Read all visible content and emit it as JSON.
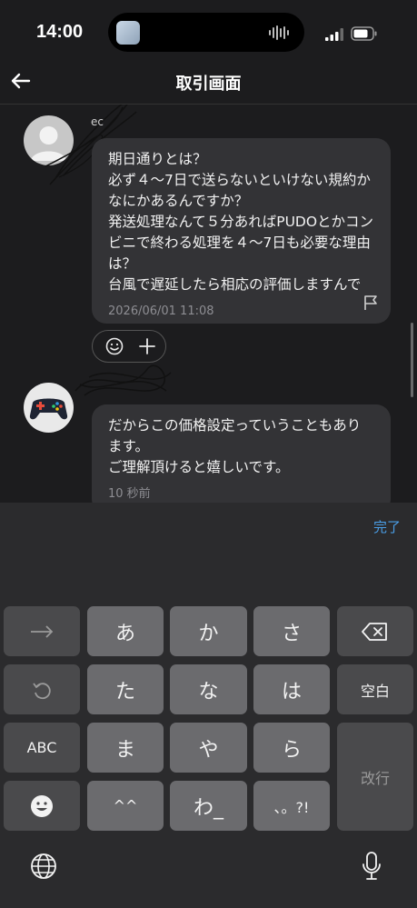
{
  "status_bar": {
    "time": "14:00"
  },
  "header": {
    "title": "取引画面"
  },
  "messages": [
    {
      "sender_partial": "ec",
      "text": "期日通りとは？\n必ず４〜7日で送らないといけない規約かなにかあるんですか？\n発送処理なんて５分あればPUDOとかコンビニで終わる処理を４〜7日も必要な理由は？\n台風で遅延したら相応の評価しますんで",
      "time": "2026/06/01 11:08"
    },
    {
      "text": "だからこの価格設定っていうこともあります。\nご理解頂けると嬉しいです。",
      "time": "10 秒前"
    }
  ],
  "keyboard": {
    "done_label": "完了",
    "row1": [
      "あ",
      "か",
      "さ"
    ],
    "row2": [
      "た",
      "な",
      "は"
    ],
    "row3": [
      "ま",
      "や",
      "ら"
    ],
    "row4": [
      "^^",
      "わ_",
      "、。?!"
    ],
    "abc_label": "ABC",
    "space_label": "空白",
    "return_label": "改行"
  },
  "icons": {
    "back": "arrow-left-icon",
    "flag": "flag-icon",
    "reaction": "smile-icon",
    "add": "plus-icon",
    "globe": "globe-icon",
    "mic": "mic-icon",
    "delete": "delete-icon",
    "undo": "undo-icon",
    "emoji": "emoji-icon",
    "next": "arrow-right-icon"
  },
  "colors": {
    "background": "#1c1c1e",
    "bubble": "#333336",
    "accent": "#4a9ee6"
  }
}
